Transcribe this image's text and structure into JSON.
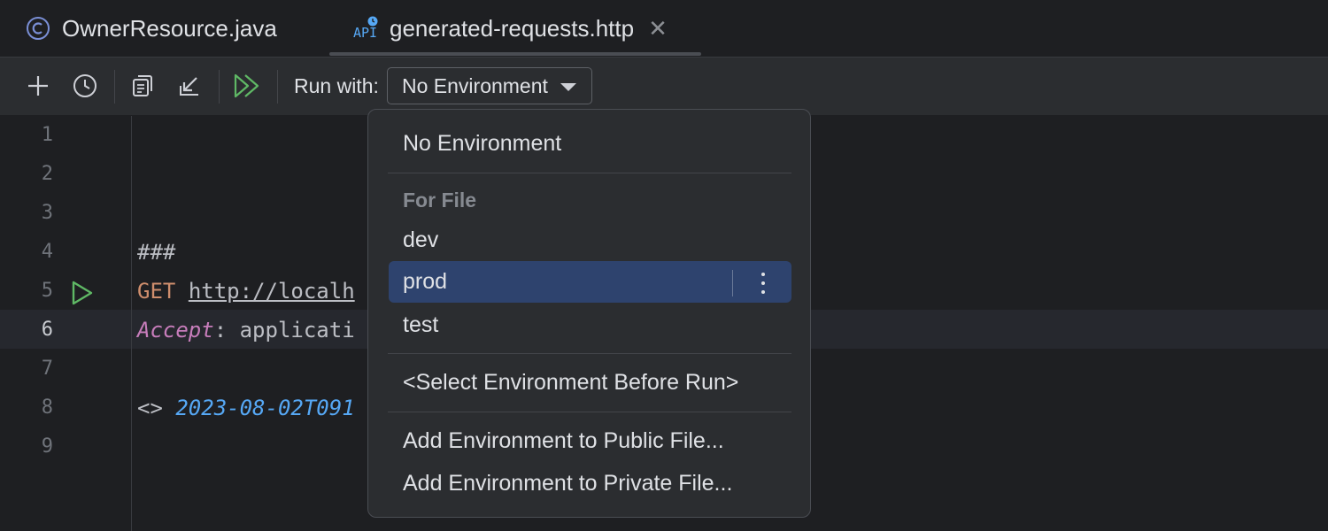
{
  "tabs": [
    {
      "label": "OwnerResource.java",
      "icon": "class-icon"
    },
    {
      "label": "generated-requests.http",
      "icon": "api-icon",
      "icon_text": "API",
      "closable": true
    }
  ],
  "toolbar": {
    "run_with_label": "Run with:",
    "environment_selected": "No Environment"
  },
  "editor": {
    "line_numbers": [
      "1",
      "2",
      "3",
      "4",
      "5",
      "6",
      "7",
      "8",
      "9"
    ],
    "active_line": 6,
    "lines": {
      "l4": "###",
      "l5_method": "GET",
      "l5_url": "http://localh",
      "l6_header": "Accept",
      "l6_sep": ": ",
      "l6_value": "applicati",
      "l8_prefix": "<> ",
      "l8_timestamp": "2023-08-02T091"
    }
  },
  "dropdown": {
    "no_environment": "No Environment",
    "section_for_file": "For File",
    "items": [
      "dev",
      "prod",
      "test"
    ],
    "selected": "prod",
    "select_before_run": "<Select Environment Before Run>",
    "add_public": "Add Environment to Public File...",
    "add_private": "Add Environment to Private File..."
  },
  "colors": {
    "background": "#1e1f22",
    "toolbar": "#2b2d30",
    "selection": "#2e436e",
    "run_green": "#5fb865",
    "keyword": "#cf8e6d",
    "header": "#c77dbb",
    "timestamp": "#56a8f5"
  }
}
